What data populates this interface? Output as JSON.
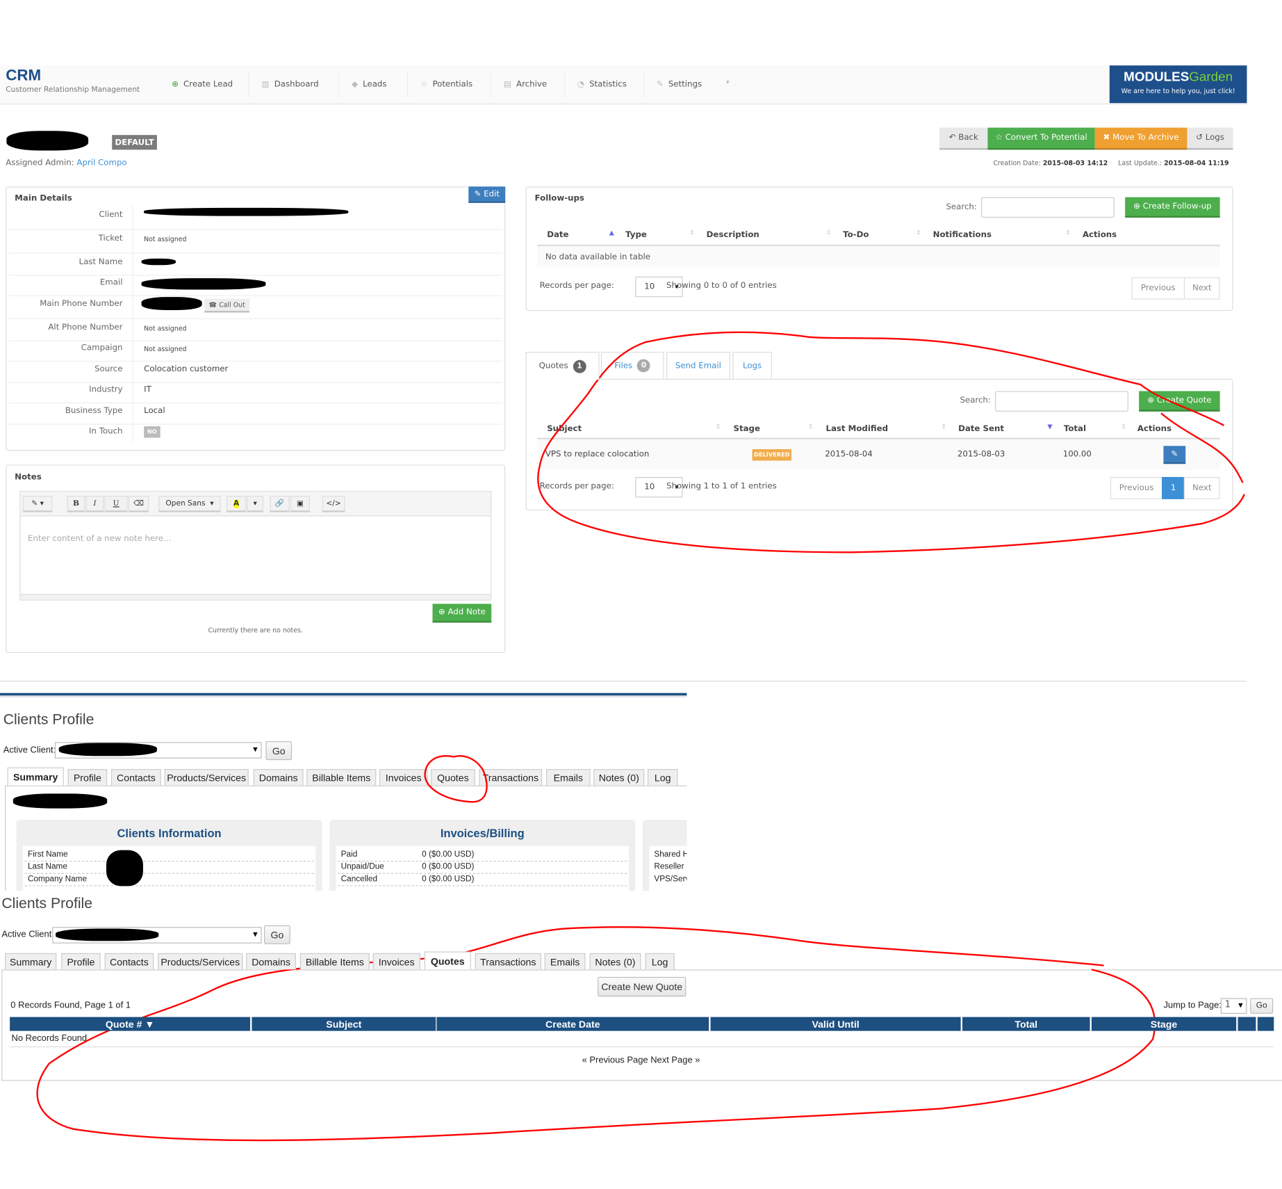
{
  "header": {
    "app_title": "CRM",
    "app_subtitle": "Customer Relationship Management",
    "nav": [
      {
        "label": "Create Lead",
        "icon": "plus-circle-icon"
      },
      {
        "label": "Dashboard",
        "icon": "bar-chart-icon"
      },
      {
        "label": "Leads",
        "icon": "tag-icon"
      },
      {
        "label": "Potentials",
        "icon": "star-icon"
      },
      {
        "label": "Archive",
        "icon": "archive-icon"
      },
      {
        "label": "Statistics",
        "icon": "pie-chart-icon"
      },
      {
        "label": "Settings",
        "icon": "wrench-icon"
      }
    ],
    "logo": {
      "brand": "MODULES Garden",
      "tagline": "We are here to help you, just click!"
    }
  },
  "lead": {
    "badge": "DEFAULT",
    "assigned_label": "Assigned Admin:",
    "assigned_admin": "April Compo",
    "creation_label": "Creation Date:",
    "creation_date": "2015-08-03 14:12",
    "update_label": "Last Update.:",
    "update_date": "2015-08-04 11:19",
    "actions": {
      "back": "Back",
      "convert": "Convert To Potential",
      "archive": "Move To Archive",
      "logs": "Logs"
    }
  },
  "main_details": {
    "title": "Main Details",
    "edit": "Edit",
    "call_out": "Call Out",
    "rows": [
      {
        "label": "Client",
        "value": ""
      },
      {
        "label": "Ticket",
        "value": "Not assigned"
      },
      {
        "label": "Last Name",
        "value": ""
      },
      {
        "label": "Email",
        "value": ""
      },
      {
        "label": "Main Phone Number",
        "value": ""
      },
      {
        "label": "Alt Phone Number",
        "value": "Not assigned"
      },
      {
        "label": "Campaign",
        "value": "Not assigned"
      },
      {
        "label": "Source",
        "value": "Colocation customer"
      },
      {
        "label": "Industry",
        "value": "IT"
      },
      {
        "label": "Business Type",
        "value": "Local"
      },
      {
        "label": "In Touch",
        "value": "NO"
      }
    ]
  },
  "notes": {
    "title": "Notes",
    "font": "Open Sans",
    "placeholder": "Enter content of a new note here...",
    "add": "Add Note",
    "empty": "Currently there are no notes.",
    "toolbar": {
      "bold": "B",
      "italic": "I",
      "underline": "U",
      "color": "A"
    }
  },
  "followups": {
    "title": "Follow-ups",
    "search_label": "Search:",
    "create": "Create Follow-up",
    "columns": [
      "Date",
      "Type",
      "Description",
      "To-Do",
      "Notifications",
      "Actions"
    ],
    "empty": "No data available in table",
    "rpp_label": "Records per page:",
    "rpp": "10",
    "showing": "Showing 0 to 0 of 0 entries",
    "prev": "Previous",
    "next": "Next"
  },
  "quotes_tabs": [
    {
      "label": "Quotes",
      "count": "1"
    },
    {
      "label": "Files",
      "count": "0"
    },
    {
      "label": "Send Email"
    },
    {
      "label": "Logs"
    }
  ],
  "quotes": {
    "search_label": "Search:",
    "create": "Create Quote",
    "columns": [
      "Subject",
      "Stage",
      "Last Modified",
      "Date Sent",
      "Total",
      "Actions"
    ],
    "rows": [
      {
        "subject": "VPS to replace colocation",
        "stage": "DELIVERED",
        "last_modified": "2015-08-04",
        "date_sent": "2015-08-03",
        "total": "100.00"
      }
    ],
    "rpp_label": "Records per page:",
    "rpp": "10",
    "showing": "Showing 1 to 1 of 1 entries",
    "prev": "Previous",
    "page": "1",
    "next": "Next"
  },
  "whmcs1": {
    "title": "Clients Profile",
    "active_client": "Active Client:",
    "go": "Go",
    "tabs": [
      "Summary",
      "Profile",
      "Contacts",
      "Products/Services",
      "Domains",
      "Billable Items",
      "Invoices",
      "Quotes",
      "Transactions",
      "Emails",
      "Notes (0)",
      "Log"
    ],
    "client_info": {
      "title": "Clients Information",
      "rows": [
        "First Name",
        "Last Name",
        "Company Name"
      ]
    },
    "billing": {
      "title": "Invoices/Billing",
      "rows": [
        {
          "label": "Paid",
          "value": "0 ($0.00 USD)"
        },
        {
          "label": "Unpaid/Due",
          "value": "0 ($0.00 USD)"
        },
        {
          "label": "Cancelled",
          "value": "0 ($0.00 USD)"
        }
      ]
    },
    "products": [
      "Shared H",
      "Reseller H",
      "VPS/Serv"
    ]
  },
  "whmcs2": {
    "title": "Clients Profile",
    "active_client": "Active Client:",
    "go": "Go",
    "tabs": [
      "Summary",
      "Profile",
      "Contacts",
      "Products/Services",
      "Domains",
      "Billable Items",
      "Invoices",
      "Quotes",
      "Transactions",
      "Emails",
      "Notes (0)",
      "Log"
    ],
    "create_quote": "Create New Quote",
    "records": "0 Records Found, Page 1 of 1",
    "jump_label": "Jump to Page:",
    "jump_value": "1",
    "jump_go": "Go",
    "columns": [
      "Quote # ▼",
      "Subject",
      "Create Date",
      "Valid Until",
      "Total",
      "Stage"
    ],
    "empty": "No Records Found",
    "pager": "« Previous Page  Next Page »"
  },
  "colors": {
    "brand": "#1d4f8b",
    "green": "#4cae4c",
    "orange": "#f0a030",
    "blue": "#3d7ebf",
    "annotation": "#ff0000"
  }
}
